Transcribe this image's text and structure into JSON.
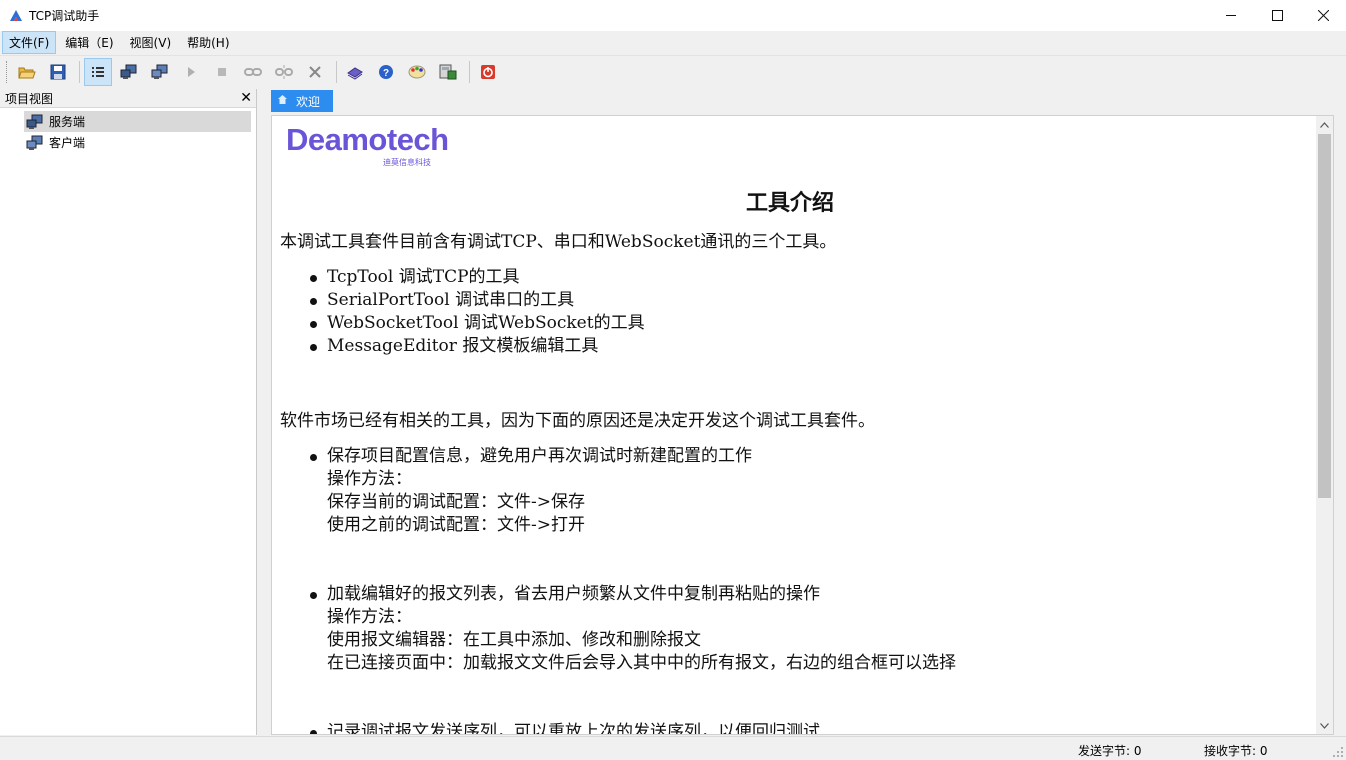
{
  "window": {
    "title": "TCP调试助手"
  },
  "menu": [
    {
      "label": "文件(F)"
    },
    {
      "label": "编辑（E)"
    },
    {
      "label": "视图(V)"
    },
    {
      "label": "帮助(H)"
    }
  ],
  "left_pane": {
    "title": "项目视图",
    "items": [
      {
        "label": "服务端"
      },
      {
        "label": "客户端"
      }
    ]
  },
  "tab": {
    "label": "欢迎"
  },
  "doc": {
    "logo": "Deamotech",
    "logo_sub": "迪莫信息科技",
    "heading": "工具介绍",
    "intro": "本调试工具套件目前含有调试TCP、串口和WebSocket通讯的三个工具。",
    "tools": [
      "TcpTool 调试TCP的工具",
      "SerialPortTool 调试串口的工具",
      "WebSocketTool 调试WebSocket的工具",
      "MessageEditor 报文模板编辑工具"
    ],
    "reason": "软件市场已经有相关的工具，因为下面的原因还是决定开发这个调试工具套件。",
    "feature1": {
      "title": "保存项目配置信息，避免用户再次调试时新建配置的工作",
      "method": "操作方法：",
      "line1": "保存当前的调试配置：文件->保存",
      "line2": "使用之前的调试配置：文件->打开"
    },
    "feature2": {
      "title": "加载编辑好的报文列表，省去用户频繁从文件中复制再粘贴的操作",
      "method": "操作方法：",
      "line1": "使用报文编辑器：在工具中添加、修改和删除报文",
      "line2": "在已连接页面中：加载报文文件后会导入其中中的所有报文，右边的组合框可以选择"
    },
    "feature3": {
      "title": "记录调试报文发送序列，可以重放上次的发送序列，以便回归测试"
    }
  },
  "status": {
    "send": "发送字节: 0",
    "recv": "接收字节: 0"
  },
  "icons": {
    "toolbar": [
      "open-folder-icon",
      "save-icon",
      "list-icon",
      "server-icon",
      "client-icon",
      "play-icon",
      "stop-icon",
      "connect-icon",
      "disconnect-icon",
      "close-x-icon",
      "book-icon",
      "help-icon",
      "palette-icon",
      "calculator-icon",
      "power-icon"
    ]
  }
}
